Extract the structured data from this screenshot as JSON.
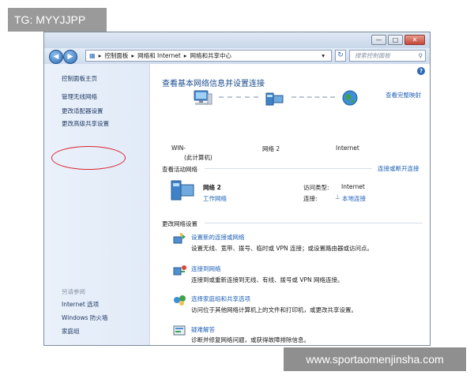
{
  "overlay": {
    "tag": "TG: MYYJJPP",
    "watermark": "www.sportaomenjinsha.com"
  },
  "window": {
    "buttons": {
      "minimize": "—",
      "maximize": "□",
      "close": "✕"
    }
  },
  "nav": {
    "back_glyph": "◀",
    "forward_glyph": "▶",
    "breadcrumb": [
      "控制面板",
      "网络和 Internet",
      "网络和共享中心"
    ],
    "separator": "▸",
    "dropdown_glyph": "▾",
    "refresh_glyph": "↻",
    "search_placeholder": "搜索控制面板"
  },
  "sidebar": {
    "items": [
      "控制面板主页",
      "管理无线网络",
      "更改适配器设置",
      "更改高级共享设置"
    ],
    "see_also_label": "另请参阅",
    "see_also": [
      "Internet 选项",
      "Windows 防火墙",
      "家庭组"
    ]
  },
  "main": {
    "title": "查看基本网络信息并设置连接",
    "view_full_map": "查看完整映射",
    "map": {
      "computer_label_1": "WIN-",
      "computer_label_2": "(此计算机)",
      "network_label": "网络 2",
      "internet_label": "Internet"
    },
    "active_section": "查看活动网络",
    "connect_disconnect": "连接或断开连接",
    "active_network": {
      "name": "网络 2",
      "type": "工作网络",
      "access_type_label": "访问类型:",
      "access_type_value": "Internet",
      "connections_label": "连接:",
      "connections_value": "本地连接"
    },
    "change_section": "更改网络设置",
    "tasks": [
      {
        "title": "设置新的连接或网络",
        "desc": "设置无线、宽带、拨号、临时或 VPN 连接；或设置路由器或访问点。"
      },
      {
        "title": "连接到网络",
        "desc": "连接到或重新连接到无线、有线、拨号或 VPN 网络连接。"
      },
      {
        "title": "选择家庭组和共享选项",
        "desc": "访问位于其他网络计算机上的文件和打印机，或更改共享设置。"
      },
      {
        "title": "疑难解答",
        "desc": "诊断并修复网络问题，或获得故障排除信息。"
      }
    ]
  },
  "colors": {
    "link": "#1d5fb5",
    "title": "#1a4b8c",
    "highlight_oval": "#d9232d"
  }
}
